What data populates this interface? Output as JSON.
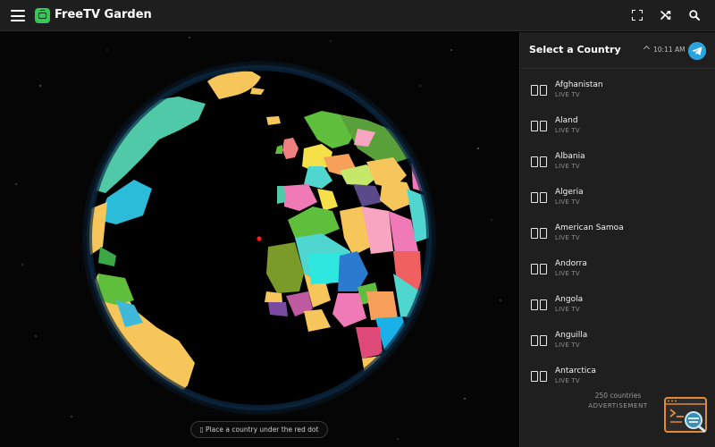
{
  "app": {
    "title": "FreeTV Garden"
  },
  "toolbar": {
    "menu_icon": "hamburger-icon",
    "fullscreen_icon": "fullscreen-icon",
    "shuffle_icon": "shuffle-icon",
    "search_icon": "search-icon"
  },
  "globe": {
    "hint": "▯ Place a country under the red dot"
  },
  "panel": {
    "title": "Select a Country",
    "time": "10:11 AM",
    "countries": [
      {
        "name": "Afghanistan",
        "sub": "LIVE TV"
      },
      {
        "name": "Aland",
        "sub": "LIVE TV"
      },
      {
        "name": "Albania",
        "sub": "LIVE TV"
      },
      {
        "name": "Algeria",
        "sub": "LIVE TV"
      },
      {
        "name": "American Samoa",
        "sub": "LIVE TV"
      },
      {
        "name": "Andorra",
        "sub": "LIVE TV"
      },
      {
        "name": "Angola",
        "sub": "LIVE TV"
      },
      {
        "name": "Anguilla",
        "sub": "LIVE TV"
      },
      {
        "name": "Antarctica",
        "sub": "LIVE TV"
      }
    ],
    "count_text": "250 countries",
    "ad_text": "ADVERTISEMENT"
  },
  "colors": {
    "accent_green": "#35c759",
    "telegram_blue": "#2aa3df",
    "ocean": "#000000",
    "atmosphere": "#1d5a8a"
  }
}
